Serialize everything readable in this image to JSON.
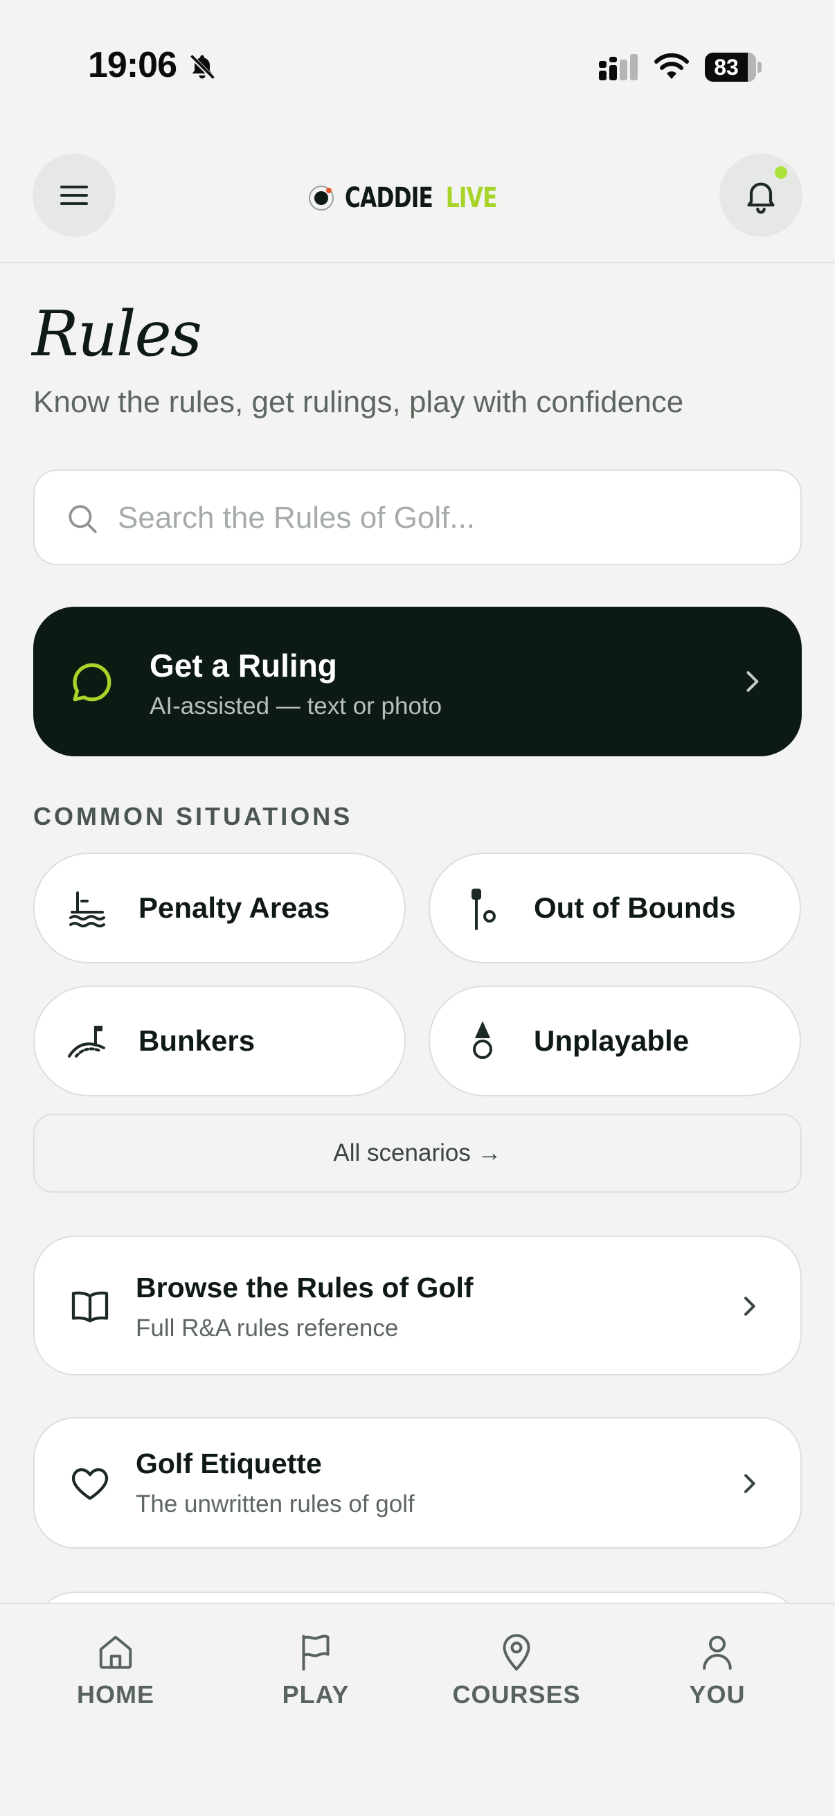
{
  "status_bar": {
    "time": "19:06",
    "battery": "83"
  },
  "header": {
    "logo_left": "CADDIE",
    "logo_right": "LIVE",
    "menu_icon": "hamburger-menu-icon",
    "notification_icon": "bell-icon"
  },
  "page": {
    "title": "Rules",
    "subtitle": "Know the rules, get rulings, play with confidence"
  },
  "search": {
    "placeholder": "Search the Rules of Golf...",
    "value": ""
  },
  "ruling": {
    "title": "Get a Ruling",
    "subtitle": "AI-assisted — text or photo",
    "icon": "chat-bubble-icon"
  },
  "common_situations": {
    "label": "COMMON SITUATIONS",
    "items": [
      {
        "label": "Penalty Areas",
        "icon": "penalty-area-icon"
      },
      {
        "label": "Out of Bounds",
        "icon": "out-of-bounds-icon"
      },
      {
        "label": "Bunkers",
        "icon": "bunker-icon"
      },
      {
        "label": "Unplayable",
        "icon": "unplayable-icon"
      }
    ],
    "all_link": "All scenarios →"
  },
  "cards": [
    {
      "title": "Browse the Rules of Golf",
      "subtitle": "Full R&A rules reference",
      "icon": "book-icon"
    },
    {
      "title": "Golf Etiquette",
      "subtitle": "The unwritten rules of golf",
      "icon": "heart-icon"
    }
  ],
  "nav": {
    "items": [
      {
        "label": "HOME",
        "icon": "home-icon"
      },
      {
        "label": "PLAY",
        "icon": "flag-icon"
      },
      {
        "label": "COURSES",
        "icon": "map-pin-icon"
      },
      {
        "label": "YOU",
        "icon": "user-icon"
      }
    ]
  },
  "colors": {
    "background": "#f3f4f2",
    "dark_card": "#0c1a13",
    "accent": "#a8d42a",
    "text_primary": "#0f1a14",
    "text_secondary": "#5d6660"
  }
}
